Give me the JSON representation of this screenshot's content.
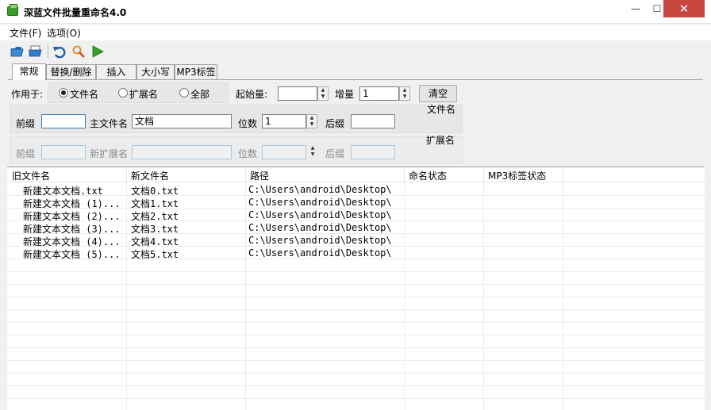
{
  "window": {
    "title": "深蓝文件批量重命名4.0",
    "min_glyph": "—",
    "max_glyph": "☐",
    "close_glyph": "✕"
  },
  "menu": {
    "file": "文件(F)",
    "options": "选项(O)"
  },
  "toolbar": {
    "icons": [
      "open-folder-icon",
      "open-file-icon",
      "undo-icon",
      "preview-icon",
      "run-icon"
    ]
  },
  "tabs": [
    "常规",
    "替换/删除",
    "插入",
    "大小写",
    "MP3标签"
  ],
  "apply": {
    "label": "作用于:",
    "options": [
      "文件名",
      "扩展名",
      "全部"
    ],
    "selected": "文件名"
  },
  "start": {
    "label": "起始量:",
    "value": ""
  },
  "increment": {
    "label": "增量",
    "value": "1"
  },
  "clear_button": "清空",
  "filename_group": {
    "title": "文件名",
    "prefix_label": "前缀",
    "prefix_value": "",
    "main_label": "主文件名",
    "main_value": "文档",
    "digits_label": "位数",
    "digits_value": "1",
    "suffix_label": "后缀",
    "suffix_value": ""
  },
  "extension_group": {
    "title": "扩展名",
    "prefix_label": "前缀",
    "main_label": "新扩展名",
    "digits_label": "位数",
    "suffix_label": "后缀"
  },
  "list": {
    "columns": [
      "旧文件名",
      "新文件名",
      "路径",
      "命名状态",
      "MP3标签状态"
    ],
    "rows": [
      {
        "old": "新建文本文档.txt",
        "new": "文档0.txt",
        "path": "C:\\Users\\android\\Desktop\\",
        "status": "",
        "mp3": ""
      },
      {
        "old": "新建文本文档 (1)...",
        "new": "文档1.txt",
        "path": "C:\\Users\\android\\Desktop\\",
        "status": "",
        "mp3": ""
      },
      {
        "old": "新建文本文档 (2)...",
        "new": "文档2.txt",
        "path": "C:\\Users\\android\\Desktop\\",
        "status": "",
        "mp3": ""
      },
      {
        "old": "新建文本文档 (3)...",
        "new": "文档3.txt",
        "path": "C:\\Users\\android\\Desktop\\",
        "status": "",
        "mp3": ""
      },
      {
        "old": "新建文本文档 (4)...",
        "new": "文档4.txt",
        "path": "C:\\Users\\android\\Desktop\\",
        "status": "",
        "mp3": ""
      },
      {
        "old": "新建文本文档 (5)...",
        "new": "文档5.txt",
        "path": "C:\\Users\\android\\Desktop\\",
        "status": "",
        "mp3": ""
      }
    ]
  }
}
